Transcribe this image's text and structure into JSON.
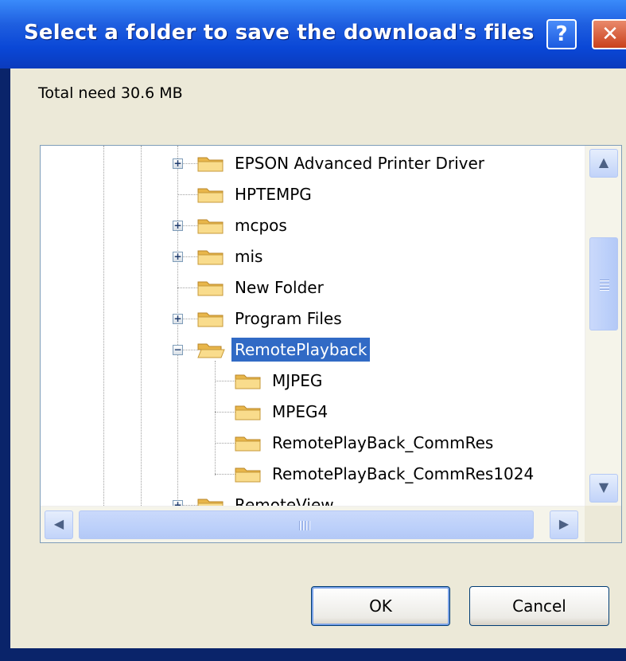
{
  "window": {
    "title": "Select a folder to save the download's files"
  },
  "titlebar_buttons": {
    "help": "?",
    "close": "✕"
  },
  "info": {
    "total_need": "Total need 30.6 MB"
  },
  "tree": {
    "items": [
      {
        "label": "EPSON Advanced Printer Driver",
        "expander": "+",
        "selected": false
      },
      {
        "label": "HPTEMPG",
        "expander": "",
        "selected": false
      },
      {
        "label": "mcpos",
        "expander": "+",
        "selected": false
      },
      {
        "label": "mis",
        "expander": "+",
        "selected": false
      },
      {
        "label": "New Folder",
        "expander": "",
        "selected": false
      },
      {
        "label": "Program Files",
        "expander": "+",
        "selected": false
      },
      {
        "label": "RemotePlayback",
        "expander": "−",
        "selected": true
      },
      {
        "label": "MJPEG",
        "expander": "",
        "selected": false
      },
      {
        "label": "MPEG4",
        "expander": "",
        "selected": false
      },
      {
        "label": "RemotePlayBack_CommRes",
        "expander": "",
        "selected": false
      },
      {
        "label": "RemotePlayBack_CommRes1024",
        "expander": "",
        "selected": false
      },
      {
        "label": "RemoteView",
        "expander": "+",
        "selected": false
      }
    ]
  },
  "scrollbar": {
    "up": "▲",
    "down": "▼",
    "left": "◀",
    "right": "▶"
  },
  "buttons": {
    "ok": "OK",
    "cancel": "Cancel"
  },
  "colors": {
    "titlebar": "#0a47d6",
    "selection": "#316ac5",
    "dialog_bg": "#ece9d8",
    "folder": "#f4d27a"
  }
}
